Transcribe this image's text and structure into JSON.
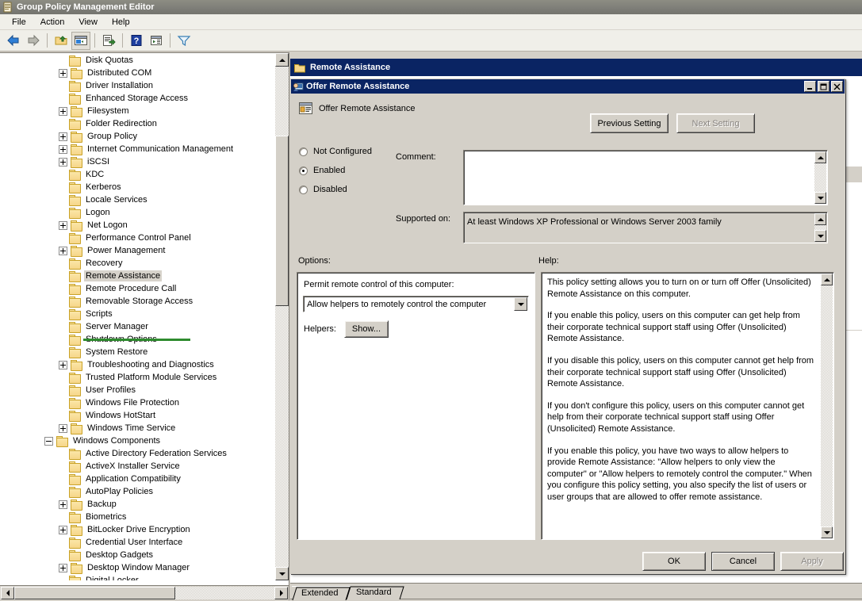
{
  "window": {
    "title": "Group Policy Management Editor",
    "icon": "console-icon"
  },
  "menu": {
    "items": [
      {
        "label": "File"
      },
      {
        "label": "Action"
      },
      {
        "label": "View"
      },
      {
        "label": "Help"
      }
    ]
  },
  "toolbar": {
    "buttons": [
      {
        "name": "back-icon"
      },
      {
        "name": "forward-icon"
      },
      {
        "name": "up-folder-icon"
      },
      {
        "name": "show-hide-tree-icon"
      },
      {
        "name": "export-list-icon"
      },
      {
        "name": "help-icon"
      },
      {
        "name": "show-properties-icon"
      },
      {
        "name": "filter-icon"
      }
    ]
  },
  "tree": {
    "items": [
      {
        "label": "Disk Quotas",
        "indent": 2,
        "expander": "none"
      },
      {
        "label": "Distributed COM",
        "indent": 2,
        "expander": "collapsed"
      },
      {
        "label": "Driver Installation",
        "indent": 2,
        "expander": "none"
      },
      {
        "label": "Enhanced Storage Access",
        "indent": 2,
        "expander": "none"
      },
      {
        "label": "Filesystem",
        "indent": 2,
        "expander": "collapsed"
      },
      {
        "label": "Folder Redirection",
        "indent": 2,
        "expander": "none"
      },
      {
        "label": "Group Policy",
        "indent": 2,
        "expander": "collapsed"
      },
      {
        "label": "Internet Communication Management",
        "indent": 2,
        "expander": "collapsed"
      },
      {
        "label": "iSCSI",
        "indent": 2,
        "expander": "collapsed"
      },
      {
        "label": "KDC",
        "indent": 2,
        "expander": "none"
      },
      {
        "label": "Kerberos",
        "indent": 2,
        "expander": "none"
      },
      {
        "label": "Locale Services",
        "indent": 2,
        "expander": "none"
      },
      {
        "label": "Logon",
        "indent": 2,
        "expander": "none"
      },
      {
        "label": "Net Logon",
        "indent": 2,
        "expander": "collapsed"
      },
      {
        "label": "Performance Control Panel",
        "indent": 2,
        "expander": "none"
      },
      {
        "label": "Power Management",
        "indent": 2,
        "expander": "collapsed"
      },
      {
        "label": "Recovery",
        "indent": 2,
        "expander": "none"
      },
      {
        "label": "Remote Assistance",
        "indent": 2,
        "expander": "none",
        "selected": true
      },
      {
        "label": "Remote Procedure Call",
        "indent": 2,
        "expander": "none"
      },
      {
        "label": "Removable Storage Access",
        "indent": 2,
        "expander": "none"
      },
      {
        "label": "Scripts",
        "indent": 2,
        "expander": "none"
      },
      {
        "label": "Server Manager",
        "indent": 2,
        "expander": "none"
      },
      {
        "label": "Shutdown Options",
        "indent": 2,
        "expander": "none"
      },
      {
        "label": "System Restore",
        "indent": 2,
        "expander": "none"
      },
      {
        "label": "Troubleshooting and Diagnostics",
        "indent": 2,
        "expander": "collapsed"
      },
      {
        "label": "Trusted Platform Module Services",
        "indent": 2,
        "expander": "none"
      },
      {
        "label": "User Profiles",
        "indent": 2,
        "expander": "none"
      },
      {
        "label": "Windows File Protection",
        "indent": 2,
        "expander": "none"
      },
      {
        "label": "Windows HotStart",
        "indent": 2,
        "expander": "none"
      },
      {
        "label": "Windows Time Service",
        "indent": 2,
        "expander": "collapsed"
      },
      {
        "label": "Windows Components",
        "indent": 1,
        "expander": "expanded"
      },
      {
        "label": "Active Directory Federation Services",
        "indent": 2,
        "expander": "none"
      },
      {
        "label": "ActiveX Installer Service",
        "indent": 2,
        "expander": "none"
      },
      {
        "label": "Application Compatibility",
        "indent": 2,
        "expander": "none"
      },
      {
        "label": "AutoPlay Policies",
        "indent": 2,
        "expander": "none"
      },
      {
        "label": "Backup",
        "indent": 2,
        "expander": "collapsed"
      },
      {
        "label": "Biometrics",
        "indent": 2,
        "expander": "none"
      },
      {
        "label": "BitLocker Drive Encryption",
        "indent": 2,
        "expander": "collapsed"
      },
      {
        "label": "Credential User Interface",
        "indent": 2,
        "expander": "none"
      },
      {
        "label": "Desktop Gadgets",
        "indent": 2,
        "expander": "none"
      },
      {
        "label": "Desktop Window Manager",
        "indent": 2,
        "expander": "collapsed"
      },
      {
        "label": "Digital Locker",
        "indent": 2,
        "expander": "none"
      }
    ]
  },
  "details": {
    "header": "Remote Assistance"
  },
  "tabs": {
    "items": [
      {
        "label": "Extended",
        "active": true
      },
      {
        "label": "Standard",
        "active": false
      }
    ]
  },
  "dialog": {
    "title": "Offer Remote Assistance",
    "titlebar_icon": "remote-assistance-icon",
    "sys_buttons": {
      "minimize": "_",
      "maximize": "□",
      "close": "✕"
    },
    "policy_name": "Offer Remote Assistance",
    "policy_icon": "policy-setting-icon",
    "prev_setting": "Previous Setting",
    "next_setting": "Next Setting",
    "state": {
      "not_configured": "Not Configured",
      "enabled": "Enabled",
      "disabled": "Disabled",
      "selected": "Enabled"
    },
    "comment_label": "Comment:",
    "comment_value": "",
    "supported_label": "Supported on:",
    "supported_value": "At least Windows XP Professional or Windows Server 2003 family",
    "options_label": "Options:",
    "help_label": "Help:",
    "options": {
      "permit_label": "Permit remote control of this computer:",
      "permit_value": "Allow helpers to remotely control the computer",
      "permit_choices": [
        "Allow helpers to only view the computer",
        "Allow helpers to remotely control the computer"
      ],
      "helpers_label": "Helpers:",
      "show_button": "Show..."
    },
    "help_paragraphs": [
      "This policy setting allows you to turn on or turn off Offer (Unsolicited) Remote Assistance on this computer.",
      "If you enable this policy, users on this computer can get help from their corporate technical support staff using Offer (Unsolicited) Remote Assistance.",
      "If you disable this policy, users on this computer cannot get help from their corporate technical support staff using Offer (Unsolicited) Remote Assistance.",
      "If you don't configure this policy, users on this computer cannot get help from their corporate technical support staff using Offer (Unsolicited) Remote Assistance.",
      "If you enable this policy, you have two ways to allow helpers to provide Remote Assistance: \"Allow helpers to only view the computer\" or \"Allow helpers to remotely control the computer.\" When you configure this policy setting, you also specify the list of users or user groups that are allowed to offer remote assistance."
    ],
    "buttons": {
      "ok": "OK",
      "cancel": "Cancel",
      "apply": "Apply",
      "apply_disabled": true
    }
  },
  "colors": {
    "titlebar_active": "#0a2463",
    "window_face": "#d4d0c8",
    "menu_face": "#f0efe9",
    "highlight_marker": "#2e8b2e",
    "selection": "#d7d3cb"
  }
}
